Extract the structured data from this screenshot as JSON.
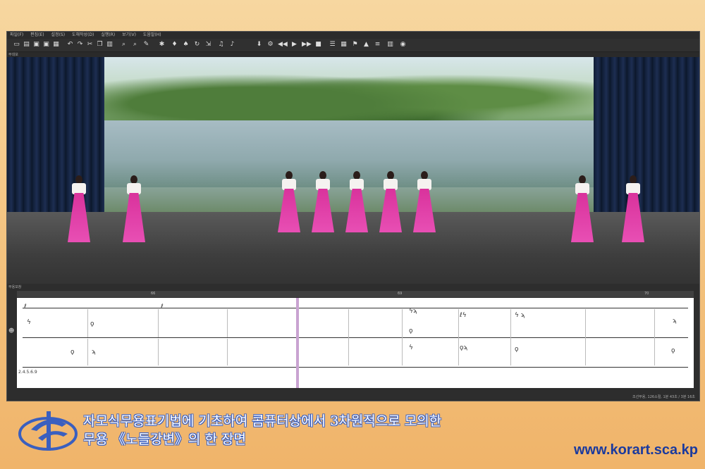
{
  "menu": {
    "items": [
      "파일(F)",
      "편집(E)",
      "설정(S)",
      "도해작성(D)",
      "실행(R)",
      "보기(V)",
      "도움말(H)"
    ]
  },
  "panels": {
    "stage_label": "무대보",
    "score_label": "무용보창"
  },
  "ruler": {
    "marks": [
      "66",
      "69",
      "70"
    ]
  },
  "score": {
    "track_label": "2.4.5.6.9"
  },
  "status": {
    "text": "조선무용, 126소절, 1분 43초 / 3분 16초"
  },
  "caption": {
    "line1": "자모식무용표기법에 기초하여 콤퓨터상에서 3차원적으로  모의한",
    "line2": "무용 《노들강변》의 한 장면"
  },
  "footer": {
    "url": "www.korart.sca.kp"
  },
  "colors": {
    "dress": "#e04aa8",
    "caption_outline": "#3a5fbf",
    "url": "#1a3a9e"
  }
}
